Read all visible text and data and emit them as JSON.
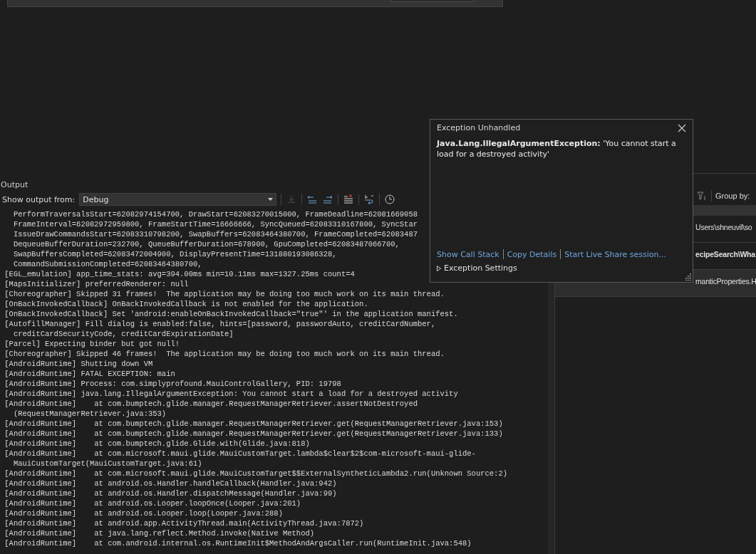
{
  "output": {
    "title": "Output",
    "source_label": "Show output from:",
    "source": "Debug",
    "lines": [
      "   PerformTraversalsStart=62082974154700, DrawStart=62083270015000, FrameDeadline=62081669058",
      "   FrameInterval=62082972959800, FrameStartTime=16666666, SyncQueued=62083310167800, SyncStar",
      "   IssueDrawCommandsStart=62083310798200, SwapBuffers=62083464380700, FrameCompleted=62083487",
      "   DequeueBufferDuration=232700, QueueBufferDuration=678900, GpuCompleted=62083487066700,",
      "   SwapBuffersCompleted=62083472004900, DisplayPresentTime=131880193086328,",
      "   CommandSubmissionCompleted=62083464380700,",
      " [EGL_emulation] app_time_stats: avg=394.00ms min=10.11ms max=1327.25ms count=4",
      " [MapsInitializer] preferredRenderer: null",
      " [Choreographer] Skipped 31 frames!  The application may be doing too much work on its main thread.",
      " [OnBackInvokedCallback] OnBackInvokedCallback is not enabled for the application.",
      " [OnBackInvokedCallback] Set 'android:enableOnBackInvokedCallback=\"true\"' in the application manifest.",
      " [AutofillManager] Fill dialog is enabled:false, hints=[password, passwordAuto, creditCardNumber,",
      "   creditCardSecurityCode, creditCardExpirationDate]",
      " [Parcel] Expecting binder but got null!",
      " [Choreographer] Skipped 46 frames!  The application may be doing too much work on its main thread.",
      " [AndroidRuntime] Shutting down VM",
      " [AndroidRuntime] FATAL EXCEPTION: main",
      " [AndroidRuntime] Process: com.simplyprofound.MauiControlGallery, PID: 19798",
      " [AndroidRuntime] java.lang.IllegalArgumentException: You cannot start a load for a destroyed activity",
      " [AndroidRuntime]    at com.bumptech.glide.manager.RequestManagerRetriever.assertNotDestroyed",
      "   (RequestManagerRetriever.java:353)",
      " [AndroidRuntime]    at com.bumptech.glide.manager.RequestManagerRetriever.get(RequestManagerRetriever.java:153)",
      " [AndroidRuntime]    at com.bumptech.glide.manager.RequestManagerRetriever.get(RequestManagerRetriever.java:133)",
      " [AndroidRuntime]    at com.bumptech.glide.Glide.with(Glide.java:818)",
      " [AndroidRuntime]    at com.microsoft.maui.glide.MauiCustomTarget.lambda$clear$2$com-microsoft-maui-glide-",
      "   MauiCustomTarget(MauiCustomTarget.java:61)",
      " [AndroidRuntime]    at com.microsoft.maui.glide.MauiCustomTarget$$ExternalSyntheticLambda2.run(Unknown Source:2)",
      " [AndroidRuntime]    at android.os.Handler.handleCallback(Handler.java:942)",
      " [AndroidRuntime]    at android.os.Handler.dispatchMessage(Handler.java:99)",
      " [AndroidRuntime]    at android.os.Looper.loopOnce(Looper.java:201)",
      " [AndroidRuntime]    at android.os.Looper.loop(Looper.java:288)",
      " [AndroidRuntime]    at android.app.ActivityThread.main(ActivityThread.java:7872)",
      " [AndroidRuntime]    at java.lang.reflect.Method.invoke(Native Method)",
      " [AndroidRuntime]    at com.android.internal.os.RuntimeInit$MethodAndArgsCaller.run(RuntimeInit.java:548)"
    ]
  },
  "error_list": {
    "group_by_label": "Group by:",
    "rows": [
      {
        "text": "Users\\shneuvil\\so",
        "bold": false,
        "highlighted": false
      },
      {
        "text": "ecipeSearch\\Wha",
        "bold": true,
        "highlighted": false
      },
      {
        "text": "manticProperties.H",
        "bold": false,
        "highlighted": true
      }
    ]
  },
  "exception_dialog": {
    "title": "Exception Unhandled",
    "message": "**Java.Lang.IllegalArgumentException:** 'You cannot start a load for a destroyed activity'",
    "links": [
      "Show Call Stack",
      "Copy Details",
      "Start Live Share session..."
    ],
    "settings": {
      "label": "Exception Settings",
      "expanded": false
    }
  }
}
